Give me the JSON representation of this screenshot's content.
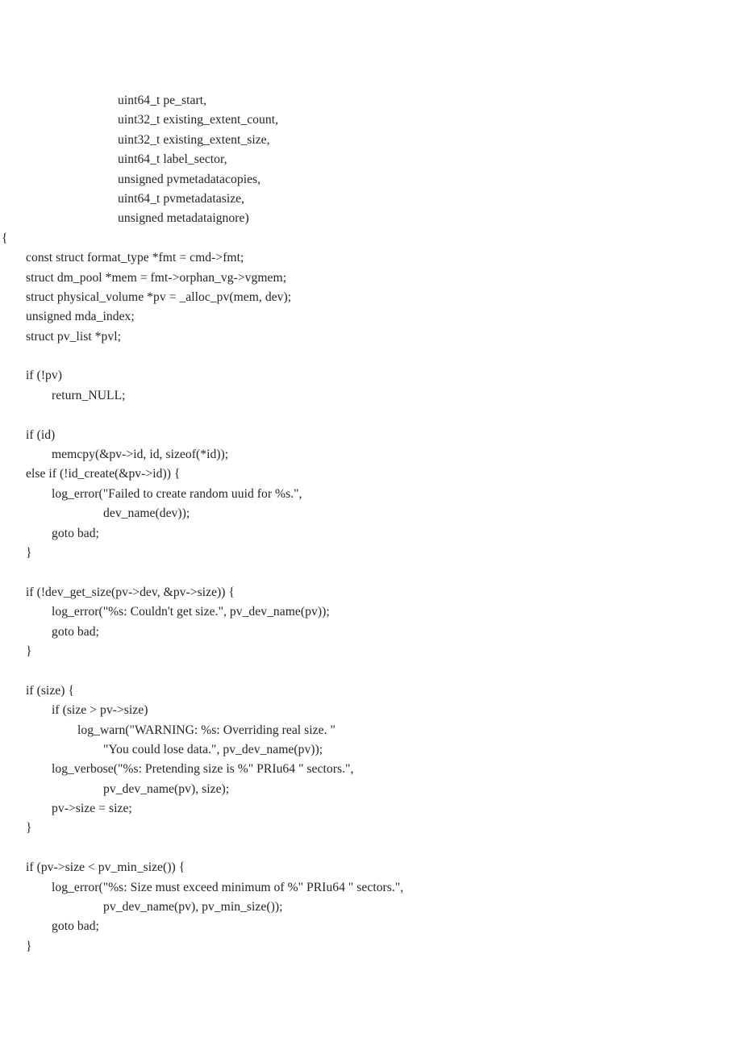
{
  "document": {
    "type": "source-code-listing",
    "language": "C",
    "background_color": "#ffffff",
    "text_color": "#242424"
  },
  "code": {
    "lines": [
      {
        "indent": "ind-p",
        "text": "uint64_t pe_start,"
      },
      {
        "indent": "ind-p",
        "text": "uint32_t existing_extent_count,"
      },
      {
        "indent": "ind-p",
        "text": "uint32_t existing_extent_size,"
      },
      {
        "indent": "ind-p",
        "text": "uint64_t label_sector,"
      },
      {
        "indent": "ind-p",
        "text": "unsigned pvmetadatacopies,"
      },
      {
        "indent": "ind-p",
        "text": "uint64_t pvmetadatasize,"
      },
      {
        "indent": "ind-p",
        "text": "unsigned metadataignore)"
      },
      {
        "indent": "ind-0",
        "text": "{"
      },
      {
        "indent": "ind-1",
        "text": "const struct format_type *fmt = cmd->fmt;"
      },
      {
        "indent": "ind-1",
        "text": "struct dm_pool *mem = fmt->orphan_vg->vgmem;"
      },
      {
        "indent": "ind-1",
        "text": "struct physical_volume *pv = _alloc_pv(mem, dev);"
      },
      {
        "indent": "ind-1",
        "text": "unsigned mda_index;"
      },
      {
        "indent": "ind-1",
        "text": "struct pv_list *pvl;"
      },
      {
        "indent": "ind-1",
        "text": ""
      },
      {
        "indent": "ind-1",
        "text": "if (!pv)"
      },
      {
        "indent": "ind-2",
        "text": "return_NULL;"
      },
      {
        "indent": "ind-1",
        "text": ""
      },
      {
        "indent": "ind-1",
        "text": "if (id)"
      },
      {
        "indent": "ind-2",
        "text": "memcpy(&pv->id, id, sizeof(*id));"
      },
      {
        "indent": "ind-1",
        "text": "else if (!id_create(&pv->id)) {"
      },
      {
        "indent": "ind-2",
        "text": "log_error(\"Failed to create random uuid for %s.\","
      },
      {
        "indent": "ind-4",
        "text": "dev_name(dev));"
      },
      {
        "indent": "ind-2",
        "text": "goto bad;"
      },
      {
        "indent": "ind-1",
        "text": "}"
      },
      {
        "indent": "ind-1",
        "text": ""
      },
      {
        "indent": "ind-1",
        "text": "if (!dev_get_size(pv->dev, &pv->size)) {"
      },
      {
        "indent": "ind-2",
        "text": "log_error(\"%s: Couldn't get size.\", pv_dev_name(pv));"
      },
      {
        "indent": "ind-2",
        "text": "goto bad;"
      },
      {
        "indent": "ind-1",
        "text": "}"
      },
      {
        "indent": "ind-1",
        "text": ""
      },
      {
        "indent": "ind-1",
        "text": "if (size) {"
      },
      {
        "indent": "ind-2",
        "text": "if (size > pv->size)"
      },
      {
        "indent": "ind-3",
        "text": "log_warn(\"WARNING: %s: Overriding real size. \""
      },
      {
        "indent": "ind-4",
        "text": "\"You could lose data.\", pv_dev_name(pv));"
      },
      {
        "indent": "ind-2",
        "text": "log_verbose(\"%s: Pretending size is %\" PRIu64 \" sectors.\","
      },
      {
        "indent": "ind-4",
        "text": "pv_dev_name(pv), size);"
      },
      {
        "indent": "ind-2",
        "text": "pv->size = size;"
      },
      {
        "indent": "ind-1",
        "text": "}"
      },
      {
        "indent": "ind-1",
        "text": ""
      },
      {
        "indent": "ind-1",
        "text": "if (pv->size < pv_min_size()) {"
      },
      {
        "indent": "ind-2",
        "text": "log_error(\"%s: Size must exceed minimum of %\" PRIu64 \" sectors.\","
      },
      {
        "indent": "ind-4",
        "text": "pv_dev_name(pv), pv_min_size());"
      },
      {
        "indent": "ind-2",
        "text": "goto bad;"
      },
      {
        "indent": "ind-1",
        "text": "}"
      }
    ]
  }
}
